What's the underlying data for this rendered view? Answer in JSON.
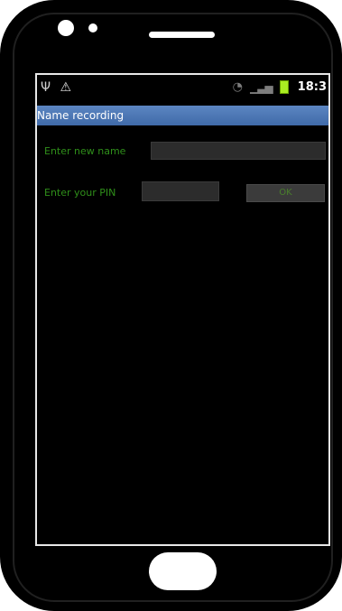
{
  "status_bar": {
    "usb_icon": "usb-icon",
    "warning_icon": "warning-icon",
    "wifi_icon": "wifi-icon",
    "signal_icon": "signal-icon",
    "battery_color": "#aaee22",
    "time": "18:3"
  },
  "title_bar": {
    "title": "Name recording",
    "color": "#4a76b6"
  },
  "form": {
    "name_label": "Enter new name",
    "name_value": "",
    "pin_label": "Enter your PIN",
    "pin_value": "",
    "ok_label": "OK",
    "label_color": "#2f8f1a"
  }
}
